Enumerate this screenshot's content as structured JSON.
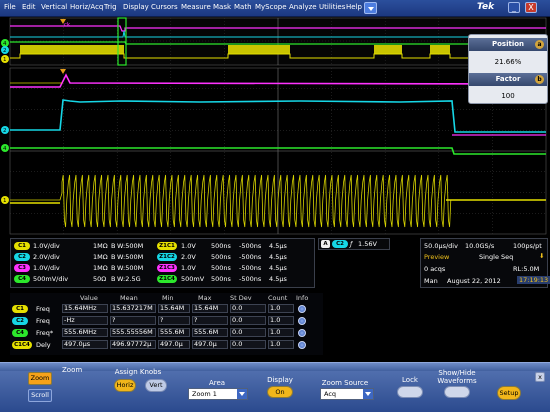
{
  "menu": {
    "items": [
      "File",
      "Edit",
      "Vertical",
      "Horiz/Acq",
      "Trig",
      "Display",
      "Cursors",
      "Measure",
      "Mask",
      "Math",
      "MyScope",
      "Analyze",
      "Utilities",
      "Help"
    ],
    "brand": "Tek",
    "minimize": "_",
    "close": "X"
  },
  "scope": {
    "ch_markers_top": [
      "4",
      "2",
      "1"
    ],
    "ch_markers_main": [
      "2",
      "4",
      "1"
    ],
    "zoom_panel": {
      "position_label": "Position",
      "position_value": "21.66%",
      "position_knob": "a",
      "factor_label": "Factor",
      "factor_value": "100",
      "factor_knob": "b"
    }
  },
  "channels": [
    {
      "name": "C1",
      "color": "#e5e000",
      "scale": "1.0V/div",
      "imp": "1MΩ",
      "bw": "B",
      "bw_val": "W:500M"
    },
    {
      "name": "C2",
      "color": "#16d7e6",
      "scale": "2.0V/div",
      "imp": "1MΩ",
      "bw": "B",
      "bw_val": "W:500M"
    },
    {
      "name": "C3",
      "color": "#ff32ff",
      "scale": "1.0V/div",
      "imp": "1MΩ",
      "bw": "B",
      "bw_val": "W:500M"
    },
    {
      "name": "C4",
      "color": "#2ce82c",
      "scale": "500mV/div",
      "imp": "50Ω",
      "bw": "B",
      "bw_val": "W:2.5G"
    }
  ],
  "zooms": [
    {
      "name": "Z1C1",
      "color": "#e5e000",
      "v": "1.0V",
      "t": "500ns",
      "off": "-500ns",
      "pos": "4.5μs"
    },
    {
      "name": "Z1C2",
      "color": "#16d7e6",
      "v": "2.0V",
      "t": "500ns",
      "off": "-500ns",
      "pos": "4.5μs"
    },
    {
      "name": "Z1C3",
      "color": "#ff32ff",
      "v": "1.0V",
      "t": "500ns",
      "off": "-500ns",
      "pos": "4.5μs"
    },
    {
      "name": "Z1C4",
      "color": "#2ce82c",
      "v": "500mV",
      "t": "500ns",
      "off": "-500ns",
      "pos": "4.5μs"
    }
  ],
  "trigger": {
    "mode": "A",
    "source": "C2",
    "slope": "ƒ",
    "level": "1.56V"
  },
  "acq": {
    "timebase": "50.0μs/div",
    "rate": "10.0GS/s",
    "pts": "100ps/pt",
    "state": "Preview",
    "seq": "Single Seq",
    "acqs": "0 acqs",
    "rl": "RL:5.0M",
    "mode": "Man",
    "date": "August 22, 2012",
    "time": "17:19:13"
  },
  "measurements": {
    "headers": [
      "Value",
      "Mean",
      "Min",
      "Max",
      "St Dev",
      "Count",
      "Info"
    ],
    "rows": [
      {
        "src": "C1",
        "color": "#e5e000",
        "name": "Freq",
        "value": "15.64MHz",
        "mean": "15.637217M",
        "min": "15.64M",
        "max": "15.64M",
        "stdev": "0.0",
        "count": "1.0"
      },
      {
        "src": "C2",
        "color": "#16d7e6",
        "name": "Freq",
        "value": "-Hz",
        "mean": "?",
        "min": "?",
        "max": "?",
        "stdev": "0.0",
        "count": "1.0"
      },
      {
        "src": "C4",
        "color": "#2ce82c",
        "name": "Freq*",
        "value": "555.6MHz",
        "mean": "555.55556M",
        "min": "555.6M",
        "max": "555.6M",
        "stdev": "0.0",
        "count": "1.0"
      },
      {
        "src": "C1C4",
        "color": "#e5e000",
        "name": "Dely",
        "value": "497.0μs",
        "mean": "496.97772μ",
        "min": "497.0μ",
        "max": "497.0μ",
        "stdev": "0.0",
        "count": "1.0"
      }
    ]
  },
  "controls": {
    "tab_zoom": "Zoom",
    "tab_scroll": "Scroll",
    "title": "Zoom",
    "assign_label": "Assign Knobs",
    "horiz": "Horiz",
    "vert": "Vert",
    "area_label": "Area",
    "area_value": "Zoom 1",
    "display_label": "Display",
    "display_value": "On",
    "source_label": "Zoom Source",
    "source_value": "Acq",
    "lock_label": "Lock",
    "showhide_label": "Show/Hide Waveforms",
    "setup": "Setup",
    "close": "x"
  }
}
